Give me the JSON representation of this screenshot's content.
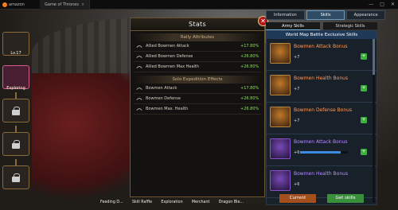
{
  "topbar": {
    "brand": "amazon",
    "tab_title": "Game of Thrones",
    "tab_close": "×",
    "controls": [
      "—",
      "□",
      "✕"
    ]
  },
  "left": {
    "labels": [
      "Exploring",
      "Lv.17"
    ],
    "item_count": 6
  },
  "stats": {
    "title": "Stats",
    "close": "✕",
    "rally": {
      "title": "Rally Attributes",
      "rows": [
        {
          "name": "Allied Bowmen Attack",
          "val": "+17.80%"
        },
        {
          "name": "Allied Bowmen Defense",
          "val": "+26.80%"
        },
        {
          "name": "Allied Bowmen Max Health",
          "val": "+26.80%"
        }
      ]
    },
    "solo": {
      "title": "Solo Expedition Effects",
      "rows": [
        {
          "name": "Bowmen Attack",
          "val": "+17.80%"
        },
        {
          "name": "Bowmen Defense",
          "val": "+26.80%"
        },
        {
          "name": "Bowmen Max. Health",
          "val": "+26.80%"
        }
      ]
    }
  },
  "right": {
    "tabs": [
      "Information",
      "Skills",
      "Appearance"
    ],
    "subtabs": [
      "Army Skills",
      "Strategic Skills"
    ],
    "panel_title": "World Map Battle Exclusive Skills",
    "skills": [
      {
        "name": "Bowmen Attack Bonus",
        "level": "+7",
        "color": "orange",
        "progress": 0.0
      },
      {
        "name": "Bowmen Health Bonus",
        "level": "+7",
        "color": "orange",
        "progress": 0.0
      },
      {
        "name": "Bowmen Defense Bonus",
        "level": "+7",
        "color": "orange",
        "progress": 0.0
      },
      {
        "name": "Bowmen Attack Bonus",
        "level": "+6",
        "color": "purple",
        "progress": 0.85
      },
      {
        "name": "Bowmen Health Bonus",
        "level": "+6",
        "color": "purple",
        "progress": 0.0
      }
    ],
    "plus": "+",
    "buttons": {
      "current": "Current",
      "get": "Get skills"
    }
  },
  "bottom": {
    "items": [
      "Feeding D...",
      "Skill Raffle",
      "Exploration",
      "Merchant",
      "Dragon Ble..."
    ]
  },
  "colors": {
    "accent": "#6e5633",
    "positive": "#8fe060"
  }
}
